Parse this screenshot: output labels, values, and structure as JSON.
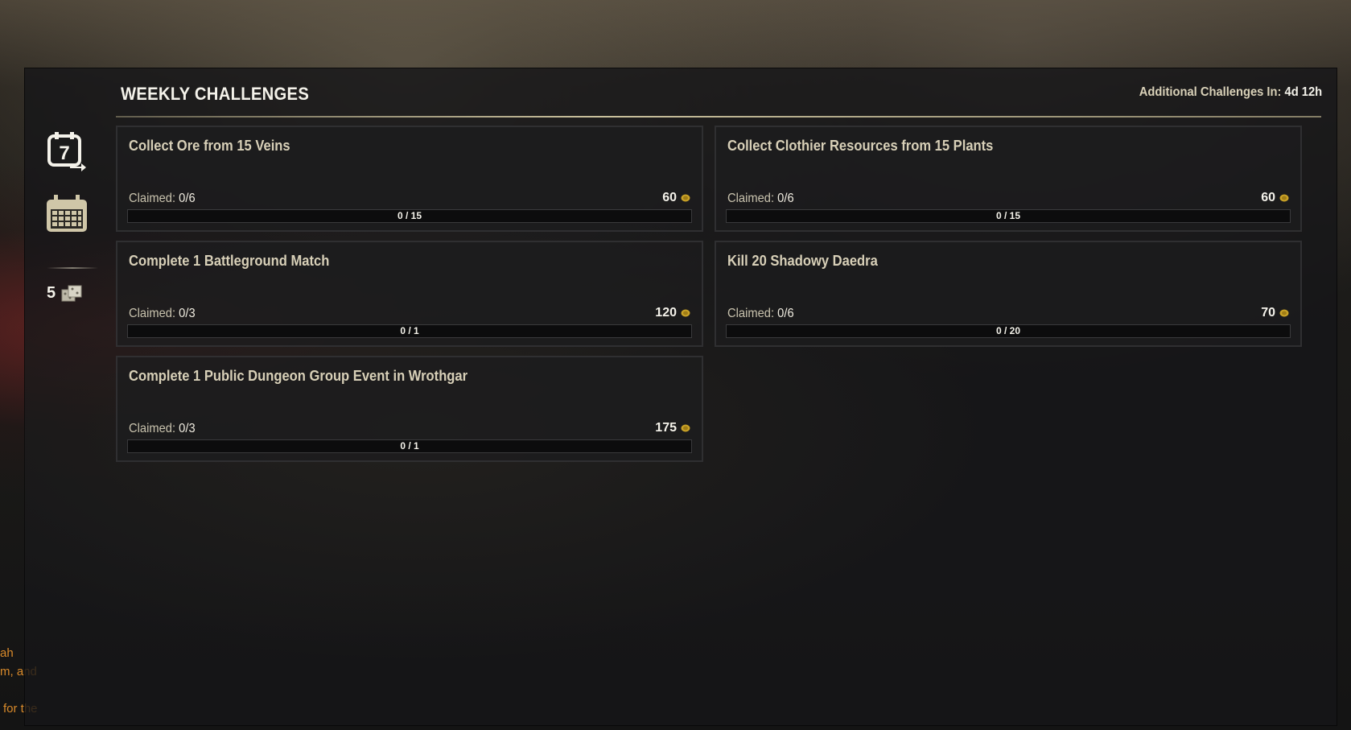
{
  "header": {
    "title": "WEEKLY CHALLENGES",
    "timer_label": "Additional Challenges In:",
    "timer_value": "4d 12h"
  },
  "sidebar": {
    "weekly_icon_number": "7",
    "tickets_count": "5"
  },
  "chat_bleed": [
    "ah",
    "m, and",
    "for the"
  ],
  "colors": {
    "accent": "#d8d0b8",
    "coin": "#c9a227",
    "chat": "#d98a2a"
  },
  "challenges": [
    {
      "title": "Collect Ore from 15 Veins",
      "claimed_label": "Claimed:",
      "claimed": "0/6",
      "reward": "60",
      "progress_text": "0 / 15",
      "progress": 0
    },
    {
      "title": "Collect Clothier Resources from 15 Plants",
      "claimed_label": "Claimed:",
      "claimed": "0/6",
      "reward": "60",
      "progress_text": "0 / 15",
      "progress": 0
    },
    {
      "title": "Complete 1 Battleground Match",
      "claimed_label": "Claimed:",
      "claimed": "0/3",
      "reward": "120",
      "progress_text": "0 / 1",
      "progress": 0
    },
    {
      "title": "Kill 20 Shadowy Daedra",
      "claimed_label": "Claimed:",
      "claimed": "0/6",
      "reward": "70",
      "progress_text": "0 / 20",
      "progress": 0
    },
    {
      "title": "Complete 1 Public Dungeon Group Event in Wrothgar",
      "claimed_label": "Claimed:",
      "claimed": "0/3",
      "reward": "175",
      "progress_text": "0 / 1",
      "progress": 0
    }
  ]
}
